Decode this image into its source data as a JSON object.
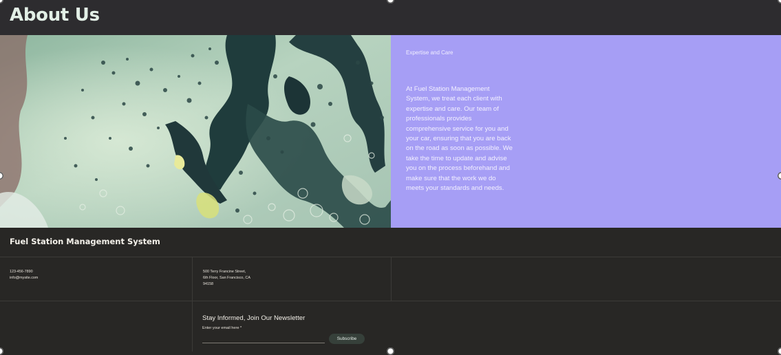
{
  "header": {
    "title": "About Us"
  },
  "panel": {
    "heading": "Expertise and Care",
    "body": "At Fuel Station Management System, we treat each client with expertise and care. Our team of professionals provides comprehensive service for you and your car, ensuring that you are back on the road as soon as possible. We take the time to update and advise you on the process beforehand and make sure that the work we do meets your standards and needs."
  },
  "footer": {
    "site_name": "Fuel Station Management System",
    "contact": {
      "phone": "123-456-7890",
      "email": "info@mysite.com"
    },
    "address": {
      "line1": "500 Terry Francine Street,",
      "line2": "6th Floor, San Francisco, CA",
      "line3": "94158"
    },
    "newsletter": {
      "title": "Stay Informed, Join Our Newsletter",
      "email_label": "Enter your email here *",
      "email_value": "",
      "subscribe_label": "Subscribe"
    }
  },
  "colors": {
    "header_bg": "#2d2c2f",
    "panel_bg": "#a69ef5",
    "footer_bg": "#282725",
    "button_bg": "#36403a"
  }
}
